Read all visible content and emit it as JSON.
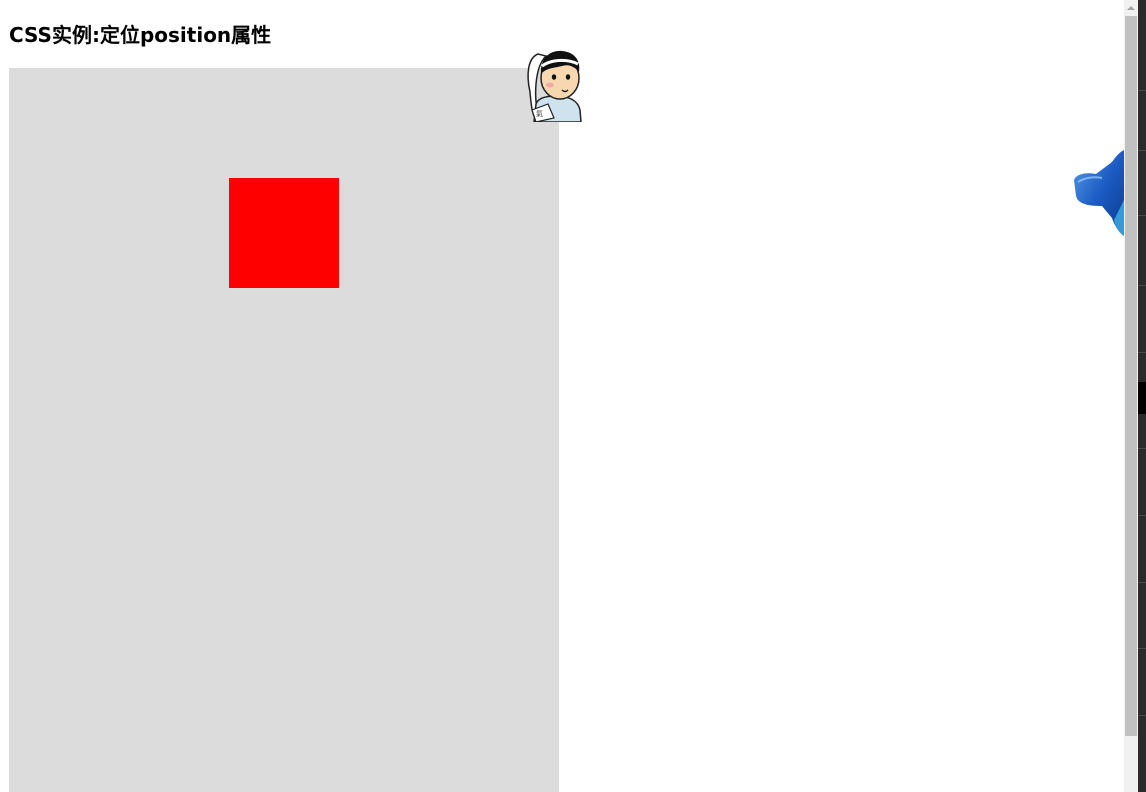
{
  "page": {
    "title": "CSS实例:定位position属性"
  },
  "colors": {
    "container_bg": "#dcdcdc",
    "box": "#ff0000",
    "page_bg": "#ffffff"
  },
  "icons": {
    "cartoon": "cartoon-character-icon",
    "megaphone": "megaphone-icon"
  },
  "cartoon": {
    "badge_text": "氣"
  }
}
